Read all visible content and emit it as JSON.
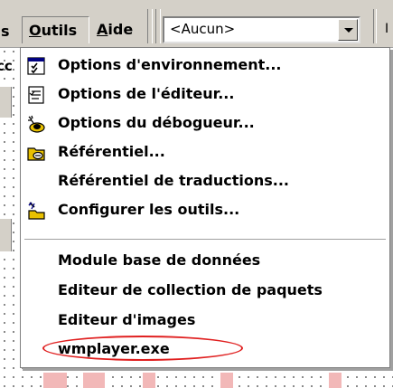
{
  "menubar": {
    "prev_item_fragment": "s",
    "items": [
      {
        "label_mnemonic": "O",
        "label_rest": "utils",
        "state": "open"
      },
      {
        "label_mnemonic": "A",
        "label_rest": "ide",
        "state": "normal"
      }
    ],
    "combo_value": "<Aucun>",
    "right_fragment": "I"
  },
  "background": {
    "left_text": "cc",
    "highlight_color": "#f2b8b8"
  },
  "dropdown": {
    "items": [
      {
        "label": "Options d'environnement...",
        "icon": "environment-options-icon"
      },
      {
        "label": "Options de l'éditeur...",
        "icon": "editor-options-icon"
      },
      {
        "label": "Options du débogueur...",
        "icon": "debugger-options-icon"
      },
      {
        "label": "Référentiel...",
        "icon": "repository-icon"
      },
      {
        "label": "Référentiel de traductions...",
        "icon": ""
      },
      {
        "label": "Configurer les outils...",
        "icon": "configure-tools-icon"
      },
      {
        "label": "Module base de données",
        "icon": ""
      },
      {
        "label": "Editeur de collection de paquets",
        "icon": ""
      },
      {
        "label": "Editeur d'images",
        "icon": ""
      },
      {
        "label": "wmplayer.exe",
        "icon": ""
      }
    ],
    "annotation": {
      "target": "wmplayer.exe",
      "color": "#e02020"
    }
  }
}
